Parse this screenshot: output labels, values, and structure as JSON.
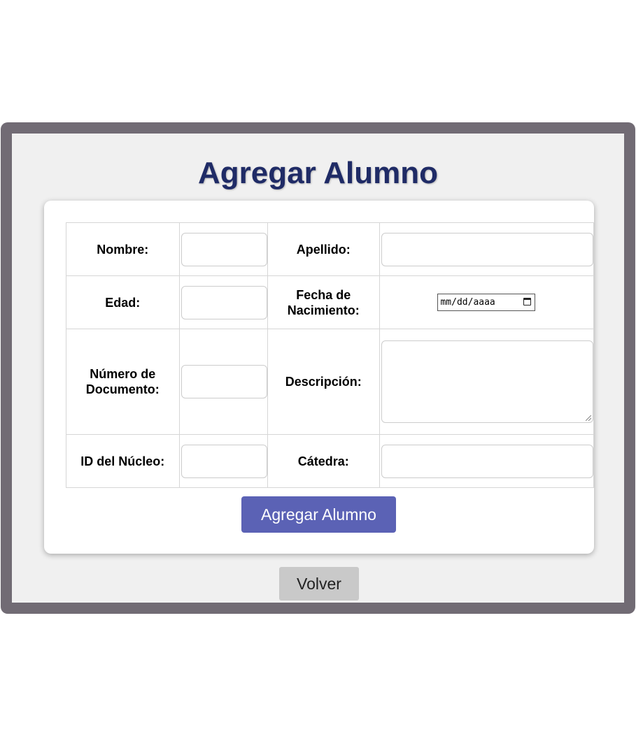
{
  "page": {
    "title": "Agregar Alumno"
  },
  "form": {
    "fields": {
      "nombre": {
        "label": "Nombre:",
        "value": ""
      },
      "apellido": {
        "label": "Apellido:",
        "value": ""
      },
      "edad": {
        "label": "Edad:",
        "value": ""
      },
      "fecha_nacimiento": {
        "label_line1": "Fecha de",
        "label_line2": "Nacimiento:",
        "placeholder": "mm/dd/aaaa"
      },
      "numero_documento": {
        "label_line1": "Número de",
        "label_line2": "Documento:",
        "value": ""
      },
      "descripcion": {
        "label": "Descripción:",
        "value": ""
      },
      "id_nucleo": {
        "label": "ID del Núcleo:",
        "value": ""
      },
      "catedra": {
        "label": "Cátedra:",
        "value": ""
      }
    },
    "submit_label": "Agregar Alumno"
  },
  "back_label": "Volver",
  "colors": {
    "frame": "#716b74",
    "title": "#1f2b66",
    "primary_button": "#5b62b5",
    "secondary_button": "#c9c9c9"
  },
  "icons": {
    "date_picker": "calendar-icon"
  }
}
